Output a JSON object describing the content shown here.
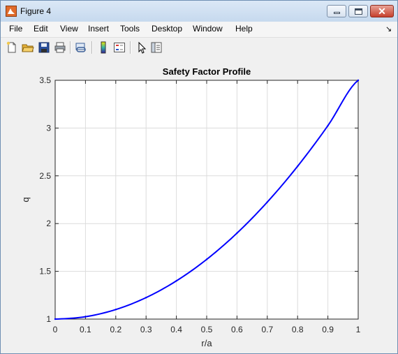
{
  "window": {
    "title": "Figure 4",
    "icons": {
      "app": "matlab-figure-icon",
      "minimize": "minimize-icon",
      "maximize": "maximize-icon",
      "close": "close-icon"
    },
    "close_glyph": "✕"
  },
  "menu": {
    "items": [
      "File",
      "Edit",
      "View",
      "Insert",
      "Tools",
      "Desktop",
      "Window",
      "Help"
    ],
    "overflow_arrow": "↘"
  },
  "toolbar": {
    "buttons": [
      "new-figure-icon",
      "open-file-icon",
      "save-icon",
      "print-icon",
      "link-plot-icon",
      "insert-colorbar-icon",
      "insert-legend-icon",
      "edit-plot-icon",
      "property-inspector-icon"
    ]
  },
  "chart_data": {
    "type": "line",
    "title": "Safety Factor Profile",
    "xlabel": "r/a",
    "ylabel": "q",
    "xlim": [
      0,
      1
    ],
    "ylim": [
      1,
      3.5
    ],
    "xticks": [
      "0",
      "0.1",
      "0.2",
      "0.3",
      "0.4",
      "0.5",
      "0.6",
      "0.7",
      "0.8",
      "0.9",
      "1"
    ],
    "yticks": [
      "1",
      "1.5",
      "2",
      "2.5",
      "3",
      "3.5"
    ],
    "grid": true,
    "color": "#0000ff",
    "x": [
      0,
      0.1,
      0.2,
      0.3,
      0.4,
      0.5,
      0.6,
      0.7,
      0.8,
      0.9,
      1.0
    ],
    "y": [
      1.0,
      1.025,
      1.1,
      1.225,
      1.4,
      1.625,
      1.9,
      2.225,
      2.6,
      3.025,
      3.5
    ]
  }
}
